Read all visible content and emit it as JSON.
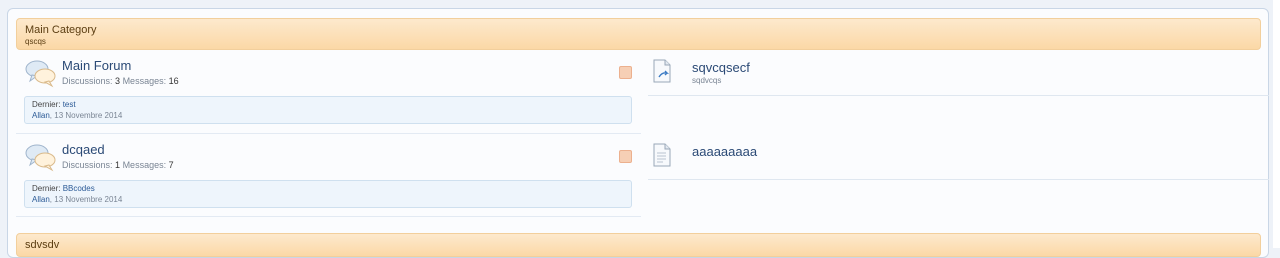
{
  "categories": [
    {
      "title": "Main Category",
      "description": "qscqs"
    },
    {
      "title": "sdvsdv"
    }
  ],
  "forums": [
    {
      "title": "Main Forum",
      "discussions_label": "Discussions:",
      "discussions": "3",
      "messages_label": "Messages:",
      "messages": "16",
      "last_prefix": "Dernier:",
      "last_thread": "test",
      "last_user": "Allan",
      "last_date": ", 13 Novembre 2014"
    },
    {
      "title": "dcqaed",
      "discussions_label": "Discussions:",
      "discussions": "1",
      "messages_label": "Messages:",
      "messages": "7",
      "last_prefix": "Dernier:",
      "last_thread": "BBcodes",
      "last_user": "Allan",
      "last_date": ", 13 Novembre 2014"
    }
  ],
  "nodes": [
    {
      "title": "sqvcqsecf",
      "subtitle": "sqdvcqs",
      "icon": "document-link-icon"
    },
    {
      "title": "aaaaaaaaa",
      "icon": "document-page-icon"
    }
  ],
  "colors": {
    "category_header": "#fbd8a6",
    "link": "#2b4a76",
    "last_post_box": "#eef5fc"
  }
}
